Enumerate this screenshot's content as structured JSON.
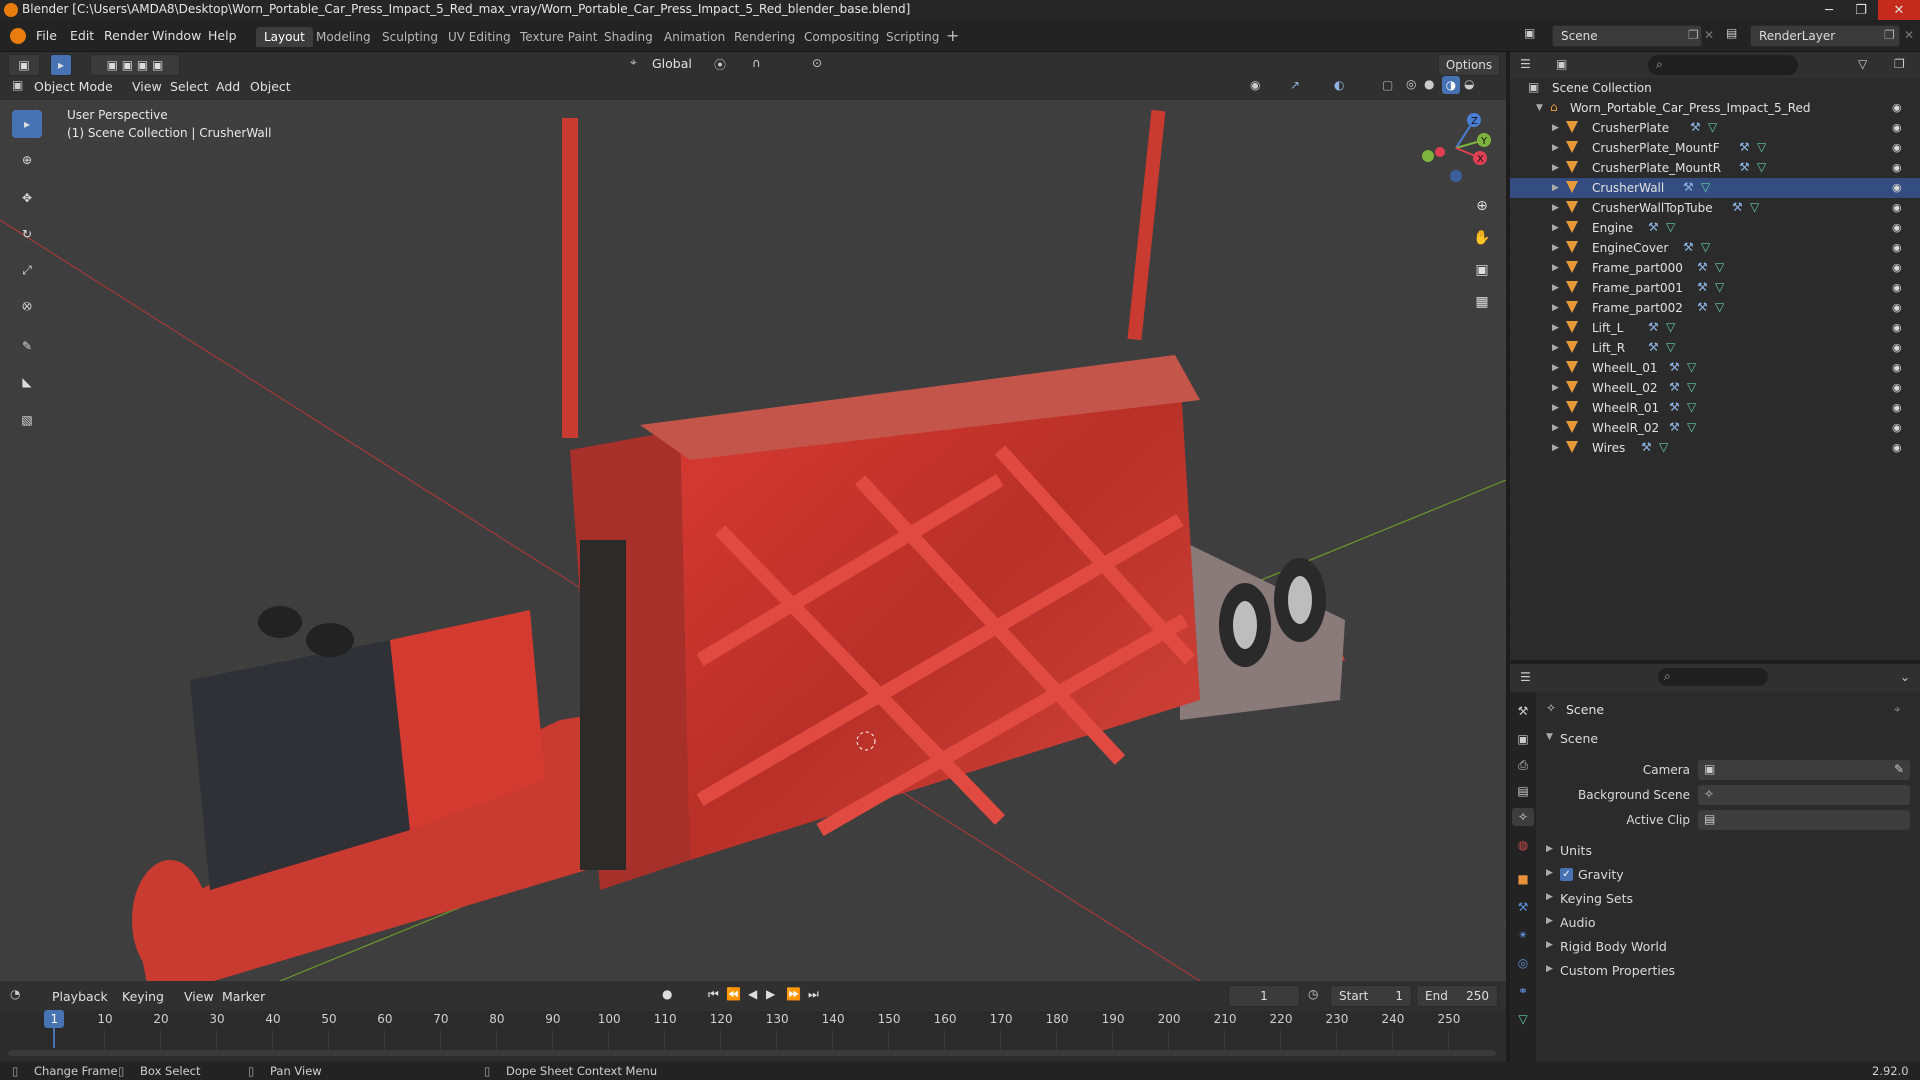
{
  "window": {
    "title": "Blender [C:\\Users\\AMDA8\\Desktop\\Worn_Portable_Car_Press_Impact_5_Red_max_vray/Worn_Portable_Car_Press_Impact_5_Red_blender_base.blend]"
  },
  "menus": [
    "File",
    "Edit",
    "Render",
    "Window",
    "Help"
  ],
  "workspaces": [
    "Layout",
    "Modeling",
    "Sculpting",
    "UV Editing",
    "Texture Paint",
    "Shading",
    "Animation",
    "Rendering",
    "Compositing",
    "Scripting"
  ],
  "active_workspace": "Layout",
  "scene_selector": "Scene",
  "view_layer": "RenderLayer",
  "viewport_header": {
    "transform_orientation": "Global",
    "options_label": "Options",
    "mode": "Object Mode",
    "menus": [
      "View",
      "Select",
      "Add",
      "Object"
    ]
  },
  "viewport": {
    "perspective_label": "User Perspective",
    "collection_label": "(1) Scene Collection | CrusherWall",
    "axis_x": "X",
    "axis_y": "Y",
    "axis_z": "Z"
  },
  "outliner": {
    "root": "Scene Collection",
    "collection": "Worn_Portable_Car_Press_Impact_5_Red",
    "items": [
      "CrusherPlate",
      "CrusherPlate_MountF",
      "CrusherPlate_MountR",
      "CrusherWall",
      "CrusherWallTopTube",
      "Engine",
      "EngineCover",
      "Frame_part000",
      "Frame_part001",
      "Frame_part002",
      "Lift_L",
      "Lift_R",
      "WheelL_01",
      "WheelL_02",
      "WheelR_01",
      "WheelR_02",
      "Wires"
    ],
    "selected": "CrusherWall"
  },
  "properties": {
    "context_title": "Scene",
    "section": "Scene",
    "fields": [
      {
        "label": "Camera",
        "value": ""
      },
      {
        "label": "Background Scene",
        "value": ""
      },
      {
        "label": "Active Clip",
        "value": ""
      }
    ],
    "panels": [
      "Units",
      "Gravity",
      "Keying Sets",
      "Audio",
      "Rigid Body World",
      "Custom Properties"
    ],
    "gravity_checked": true
  },
  "timeline": {
    "menus": [
      "Playback",
      "Keying",
      "View",
      "Marker"
    ],
    "current_frame": "1",
    "start_label": "Start",
    "start": "1",
    "end_label": "End",
    "end": "250",
    "ticks": [
      "1",
      "10",
      "20",
      "30",
      "40",
      "50",
      "60",
      "70",
      "80",
      "90",
      "100",
      "110",
      "120",
      "130",
      "140",
      "150",
      "160",
      "170",
      "180",
      "190",
      "200",
      "210",
      "220",
      "230",
      "240",
      "250"
    ]
  },
  "statusbar": {
    "items": [
      "Change Frame",
      "Box Select",
      "Pan View",
      "Dope Sheet Context Menu"
    ],
    "version": "2.92.0"
  },
  "colors": {
    "accent": "#4772b3",
    "object_red": "#d93a32",
    "outliner_mesh": "#64c9a4",
    "selected_row": "#334d80"
  }
}
